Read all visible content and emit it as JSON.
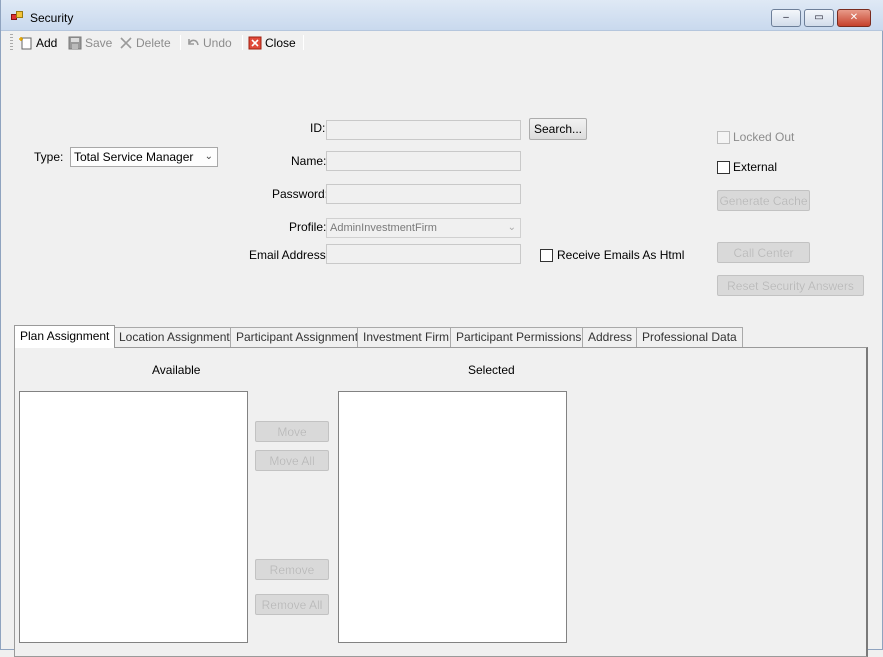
{
  "window": {
    "title": "Security",
    "controls": {
      "minimize": "‒",
      "maximize": "▭",
      "close": "✕"
    }
  },
  "toolbar": {
    "items": [
      {
        "label": "Add",
        "icon": "add-document-icon",
        "enabled": true
      },
      {
        "label": "Save",
        "icon": "floppy-disk-icon",
        "enabled": false
      },
      {
        "label": "Delete",
        "icon": "x-delete-icon",
        "enabled": false
      },
      {
        "label": "Undo",
        "icon": "undo-arrow-icon",
        "enabled": false
      },
      {
        "label": "Close",
        "icon": "red-close-icon",
        "enabled": true
      }
    ]
  },
  "form": {
    "type": {
      "label": "Type:",
      "value": "Total Service Manager"
    },
    "id": {
      "label": "ID:",
      "value": ""
    },
    "search_button": "Search...",
    "name": {
      "label": "Name:",
      "value": ""
    },
    "password": {
      "label": "Password:",
      "value": ""
    },
    "profile": {
      "label": "Profile:",
      "value": "AdminInvestmentFirm"
    },
    "email": {
      "label": "Email Address:",
      "value": ""
    },
    "receive_html": {
      "label": "Receive Emails As Html",
      "checked": false
    },
    "locked_out": {
      "label": "Locked Out",
      "checked": false,
      "enabled": false
    },
    "external": {
      "label": "External",
      "checked": false
    },
    "generate_cache": "Generate Cache",
    "call_center": "Call Center",
    "reset_security": "Reset Security Answers"
  },
  "tabs": [
    {
      "label": "Plan Assignment",
      "active": true
    },
    {
      "label": "Location Assignment",
      "active": false
    },
    {
      "label": "Participant Assignment",
      "active": false
    },
    {
      "label": "Investment Firm",
      "active": false
    },
    {
      "label": "Participant Permissions",
      "active": false
    },
    {
      "label": "Address",
      "active": false
    },
    {
      "label": "Professional Data",
      "active": false
    }
  ],
  "plan_assignment": {
    "available_label": "Available",
    "selected_label": "Selected",
    "move": "Move",
    "move_all": "Move All",
    "remove": "Remove",
    "remove_all": "Remove All",
    "available_items": [],
    "selected_items": []
  }
}
